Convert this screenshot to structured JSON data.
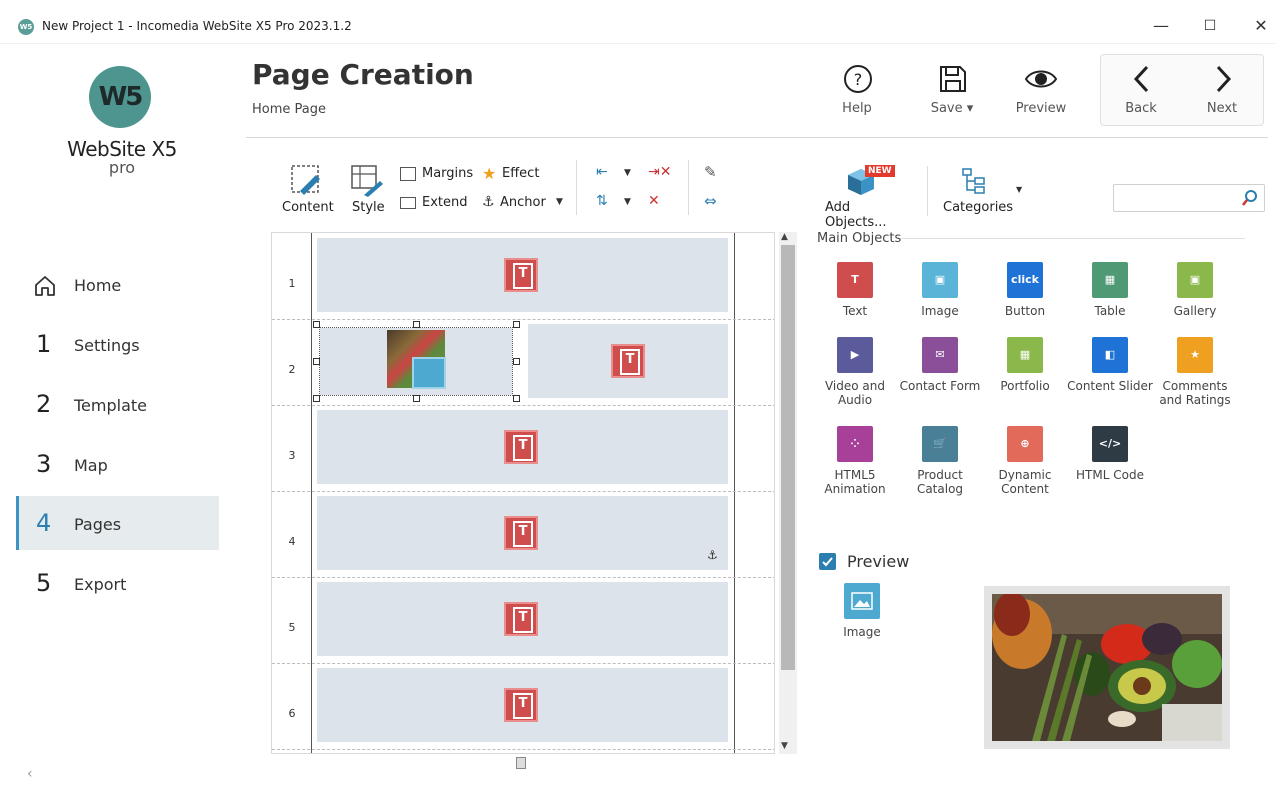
{
  "window": {
    "title": "New Project 1 - Incomedia WebSite X5 Pro 2023.1.2",
    "icon_text": "W5",
    "controls": {
      "minimize": "—",
      "maximize": "☐",
      "close": "✕"
    }
  },
  "logo": {
    "mark": "W5",
    "name": "WebSite X5",
    "edition": "pro"
  },
  "sidebar": {
    "items": [
      {
        "num": "",
        "label": "Home"
      },
      {
        "num": "1",
        "label": "Settings"
      },
      {
        "num": "2",
        "label": "Template"
      },
      {
        "num": "3",
        "label": "Map"
      },
      {
        "num": "4",
        "label": "Pages"
      },
      {
        "num": "5",
        "label": "Export"
      }
    ],
    "active": "Pages",
    "scroll_glyph": "‹"
  },
  "header": {
    "title": "Page Creation",
    "breadcrumb": "Home Page",
    "help": "Help",
    "save": "Save ▾",
    "preview": "Preview",
    "back": "Back",
    "next": "Next"
  },
  "toolbar": {
    "content": "Content",
    "style": "Style",
    "margins": "Margins",
    "effect": "Effect",
    "extend": "Extend",
    "anchor": "Anchor",
    "add_objects": "Add Objects...",
    "new_badge": "NEW",
    "categories": "Categories",
    "search_placeholder": ""
  },
  "grid": {
    "rows": [
      "1",
      "2",
      "3",
      "4",
      "5",
      "6"
    ]
  },
  "objects": {
    "heading": "Main Objects",
    "items": [
      {
        "name": "Text",
        "color": "#cf4d4d",
        "glyph": "T"
      },
      {
        "name": "Image",
        "color": "#5ab4d8",
        "glyph": "▣"
      },
      {
        "name": "Button",
        "color": "#1f73d6",
        "glyph": "click"
      },
      {
        "name": "Table",
        "color": "#4f9a74",
        "glyph": "▦"
      },
      {
        "name": "Gallery",
        "color": "#8ab84a",
        "glyph": "▣"
      },
      {
        "name": "Video and Audio",
        "color": "#5b5b9c",
        "glyph": "▶"
      },
      {
        "name": "Contact Form",
        "color": "#8b4f9a",
        "glyph": "✉"
      },
      {
        "name": "Portfolio",
        "color": "#8ab84a",
        "glyph": "▦"
      },
      {
        "name": "Content Slider",
        "color": "#1f73d6",
        "glyph": "◧"
      },
      {
        "name": "Comments and Ratings",
        "color": "#f0a020",
        "glyph": "★"
      },
      {
        "name": "HTML5 Animation",
        "color": "#a8409a",
        "glyph": "⁘"
      },
      {
        "name": "Product Catalog",
        "color": "#4a7f98",
        "glyph": "🛒"
      },
      {
        "name": "Dynamic Content",
        "color": "#e26a5a",
        "glyph": "⊕"
      },
      {
        "name": "HTML Code",
        "color": "#2e3a44",
        "glyph": "</>"
      }
    ]
  },
  "preview": {
    "label": "Preview",
    "checked": true,
    "selected_object": "Image"
  }
}
